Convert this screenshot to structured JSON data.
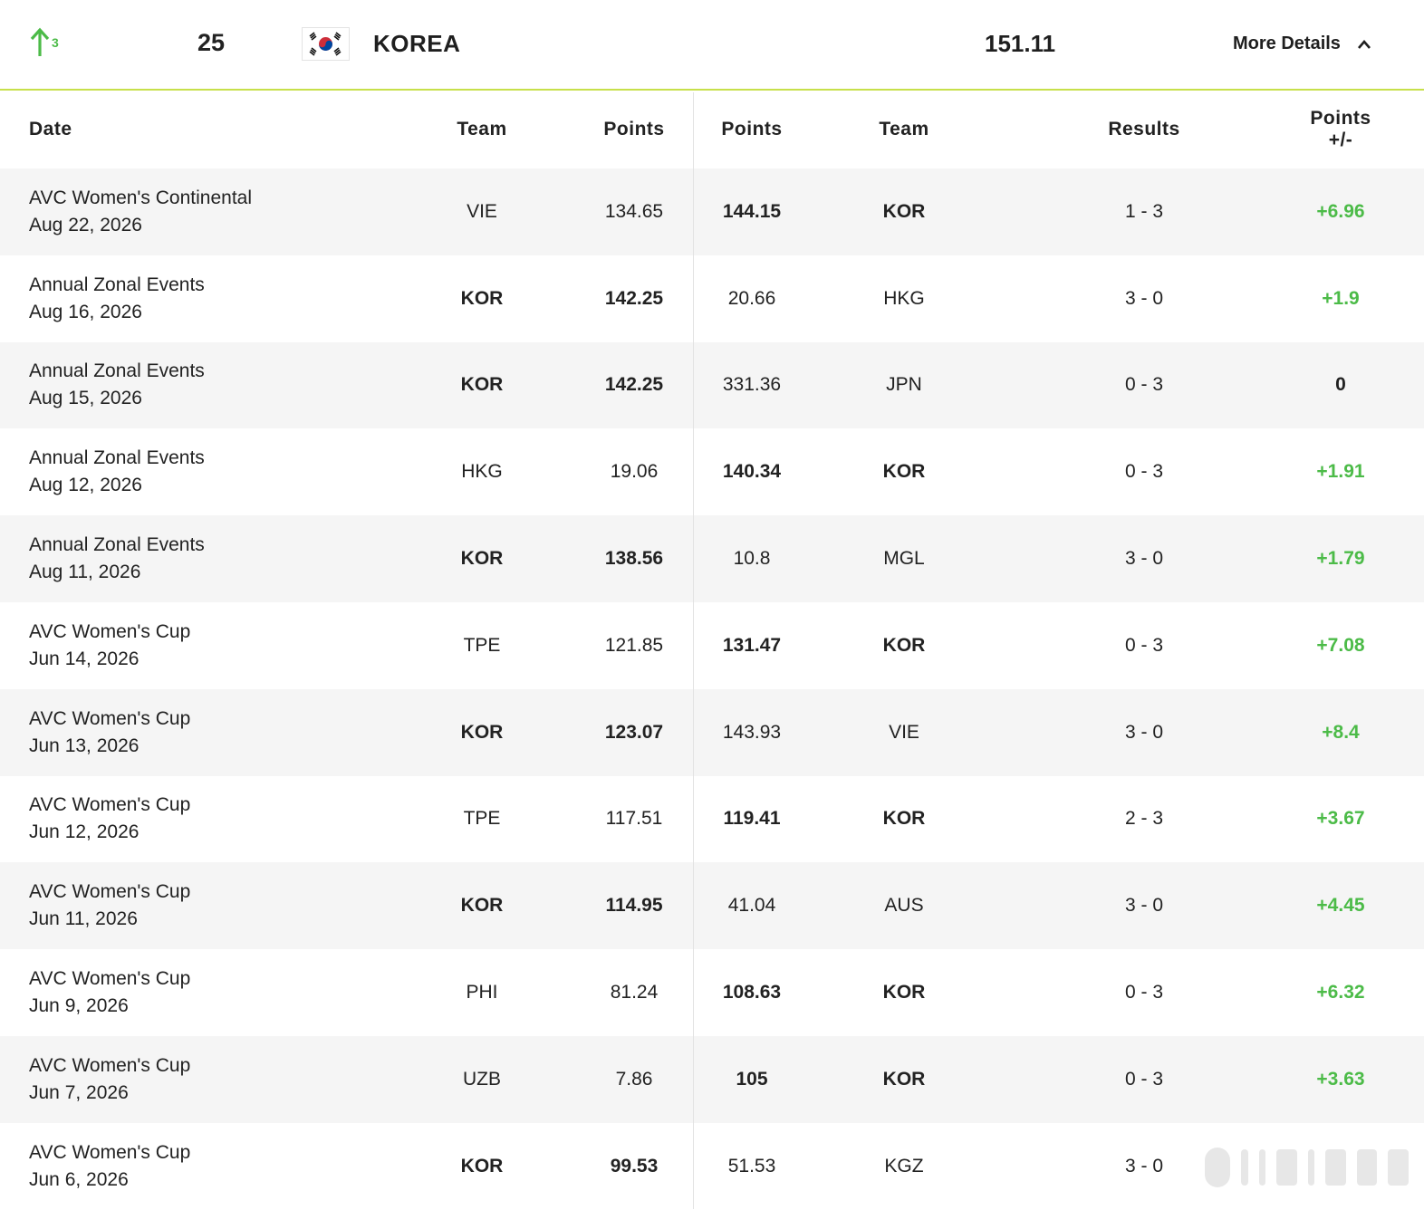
{
  "header": {
    "rank_change": "3",
    "rank": "25",
    "country": "KOREA",
    "total_points": "151.11",
    "more_details_label": "More Details"
  },
  "columns": {
    "date": "Date",
    "team1": "Team",
    "points1": "Points",
    "points2": "Points",
    "team2": "Team",
    "results": "Results",
    "points_delta": "Points +/-"
  },
  "colors": {
    "accent_line": "#c7e04a",
    "positive": "#4cbb48",
    "row_shade": "#f5f5f5"
  },
  "rows": [
    {
      "event": "AVC Women's Continental",
      "date": "Aug 22, 2026",
      "team1": "VIE",
      "points1": "134.65",
      "points2": "144.15",
      "team2": "KOR",
      "result": "1 - 3",
      "delta": "+6.96",
      "winner": 2
    },
    {
      "event": "Annual Zonal Events",
      "date": "Aug 16, 2026",
      "team1": "KOR",
      "points1": "142.25",
      "points2": "20.66",
      "team2": "HKG",
      "result": "3 - 0",
      "delta": "+1.9",
      "winner": 1
    },
    {
      "event": "Annual Zonal Events",
      "date": "Aug 15, 2026",
      "team1": "KOR",
      "points1": "142.25",
      "points2": "331.36",
      "team2": "JPN",
      "result": "0 - 3",
      "delta": "0",
      "winner": 1
    },
    {
      "event": "Annual Zonal Events",
      "date": "Aug 12, 2026",
      "team1": "HKG",
      "points1": "19.06",
      "points2": "140.34",
      "team2": "KOR",
      "result": "0 - 3",
      "delta": "+1.91",
      "winner": 2
    },
    {
      "event": "Annual Zonal Events",
      "date": "Aug 11, 2026",
      "team1": "KOR",
      "points1": "138.56",
      "points2": "10.8",
      "team2": "MGL",
      "result": "3 - 0",
      "delta": "+1.79",
      "winner": 1
    },
    {
      "event": "AVC Women's Cup",
      "date": "Jun 14, 2026",
      "team1": "TPE",
      "points1": "121.85",
      "points2": "131.47",
      "team2": "KOR",
      "result": "0 - 3",
      "delta": "+7.08",
      "winner": 2
    },
    {
      "event": "AVC Women's Cup",
      "date": "Jun 13, 2026",
      "team1": "KOR",
      "points1": "123.07",
      "points2": "143.93",
      "team2": "VIE",
      "result": "3 - 0",
      "delta": "+8.4",
      "winner": 1
    },
    {
      "event": "AVC Women's Cup",
      "date": "Jun 12, 2026",
      "team1": "TPE",
      "points1": "117.51",
      "points2": "119.41",
      "team2": "KOR",
      "result": "2 - 3",
      "delta": "+3.67",
      "winner": 2
    },
    {
      "event": "AVC Women's Cup",
      "date": "Jun 11, 2026",
      "team1": "KOR",
      "points1": "114.95",
      "points2": "41.04",
      "team2": "AUS",
      "result": "3 - 0",
      "delta": "+4.45",
      "winner": 1
    },
    {
      "event": "AVC Women's Cup",
      "date": "Jun 9, 2026",
      "team1": "PHI",
      "points1": "81.24",
      "points2": "108.63",
      "team2": "KOR",
      "result": "0 - 3",
      "delta": "+6.32",
      "winner": 2
    },
    {
      "event": "AVC Women's Cup",
      "date": "Jun 7, 2026",
      "team1": "UZB",
      "points1": "7.86",
      "points2": "105",
      "team2": "KOR",
      "result": "0 - 3",
      "delta": "+3.63",
      "winner": 2
    },
    {
      "event": "AVC Women's Cup",
      "date": "Jun 6, 2026",
      "team1": "KOR",
      "points1": "99.53",
      "points2": "51.53",
      "team2": "KGZ",
      "result": "3 - 0",
      "delta": "",
      "winner": 1
    }
  ]
}
